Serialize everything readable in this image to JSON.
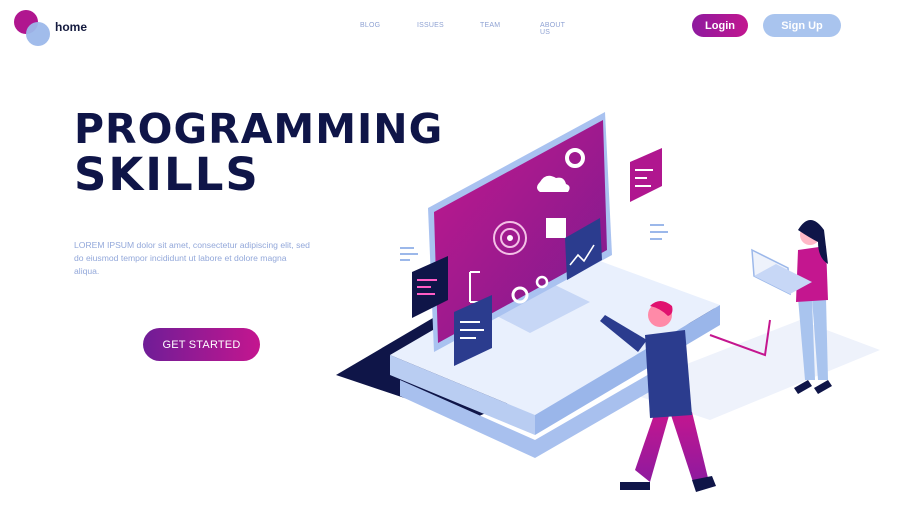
{
  "header": {
    "brand": "home",
    "nav": [
      "BLOG",
      "ISSUES",
      "TEAM",
      "ABOUT US"
    ],
    "login_label": "Login",
    "signup_label": "Sign Up"
  },
  "hero": {
    "title_line1": "PROGRAMMING",
    "title_line2": "SKILLS",
    "description": "LOREM IPSUM dolor sit amet, consectetur adipiscing elit, sed do eiusmod tempor incididunt ut labore et dolore magna aliqua.",
    "cta_label": "GET STARTED"
  },
  "colors": {
    "navy": "#0f1548",
    "magenta": "#c4168f",
    "purple": "#6f1d97",
    "light_blue": "#a9c4ee",
    "nav_text": "#8fa2d3"
  },
  "illustration": {
    "icons": [
      "monitor-icon",
      "gear-icon",
      "cloud-icon",
      "code-icon",
      "folder-icon",
      "chart-icon",
      "envelope-icon"
    ]
  }
}
